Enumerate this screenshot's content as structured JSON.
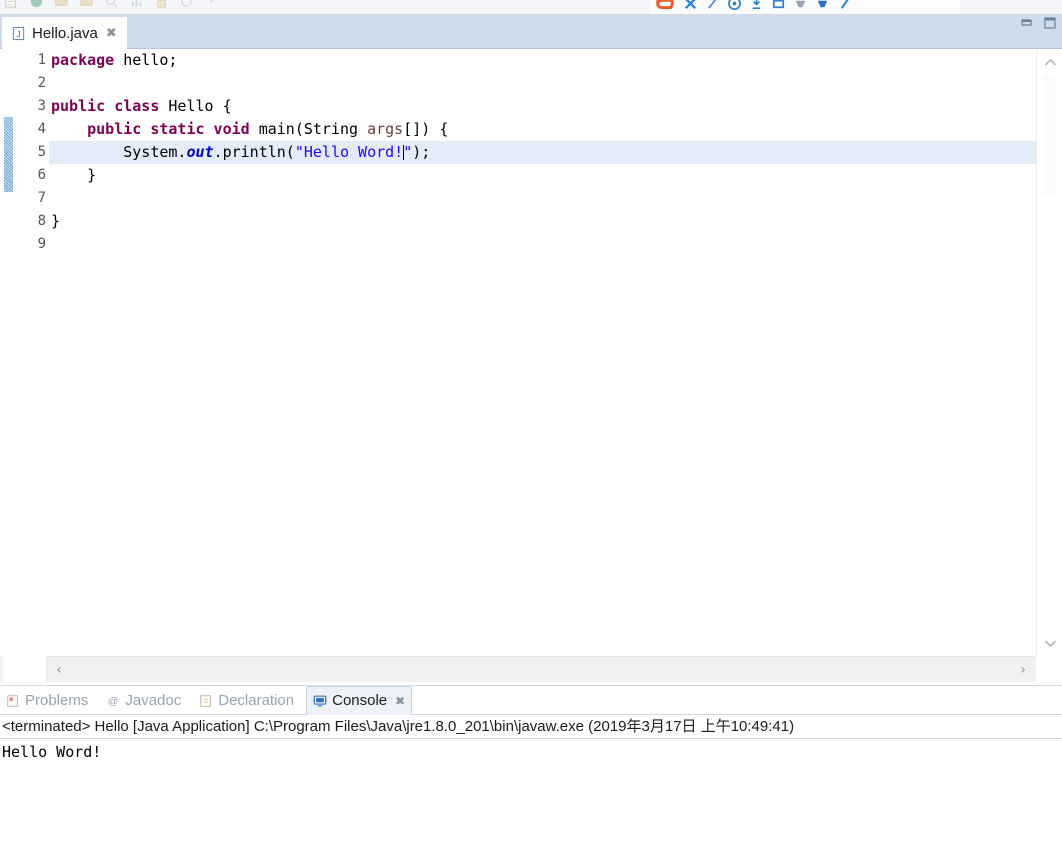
{
  "toolbar": {
    "left_icons": [
      "new-icon",
      "save-icon",
      "print-icon",
      "export-icon",
      "import-icon",
      "search-icon",
      "chart-icon",
      "lock-icon",
      "refresh-icon",
      "more-icon"
    ],
    "right_icons": [
      "browser-logo-icon",
      "text-tool-icon",
      "pen-icon",
      "smiley-icon",
      "crop-icon",
      "frame-icon",
      "shape-icon",
      "fill-icon",
      "brush-icon"
    ],
    "accent_orange": "#f05a28",
    "accent_blue": "#2f7fd4"
  },
  "window": {
    "minimize_icon": "minimize-icon",
    "maximize_icon": "maximize-icon"
  },
  "editor": {
    "tab": {
      "label": "Hello.java",
      "icon": "java-file-icon",
      "close": "✖"
    },
    "line_numbers": [
      "1",
      "2",
      "3",
      "4",
      "5",
      "6",
      "7",
      "8",
      "9"
    ],
    "fold_line": 4,
    "current_line": 5,
    "code": [
      [
        {
          "t": "package",
          "c": "kw"
        },
        {
          "t": " hello;",
          "c": "plain"
        }
      ],
      [
        {
          "t": "",
          "c": "plain"
        }
      ],
      [
        {
          "t": "public class",
          "c": "kw"
        },
        {
          "t": " Hello {",
          "c": "plain"
        }
      ],
      [
        {
          "t": "    ",
          "c": "plain"
        },
        {
          "t": "public static void",
          "c": "kw"
        },
        {
          "t": " main(String ",
          "c": "plain"
        },
        {
          "t": "args",
          "c": "param"
        },
        {
          "t": "[]) {",
          "c": "plain"
        }
      ],
      [
        {
          "t": "        System.",
          "c": "plain"
        },
        {
          "t": "out",
          "c": "field"
        },
        {
          "t": ".println(",
          "c": "plain"
        },
        {
          "t": "\"Hello Word!",
          "c": "str"
        },
        {
          "t": "|caret|",
          "c": "caret"
        },
        {
          "t": "\"",
          "c": "str"
        },
        {
          "t": ");",
          "c": "plain"
        }
      ],
      [
        {
          "t": "    }",
          "c": "plain"
        }
      ],
      [
        {
          "t": "",
          "c": "plain"
        }
      ],
      [
        {
          "t": "}",
          "c": "plain"
        }
      ],
      [
        {
          "t": "",
          "c": "plain"
        }
      ]
    ],
    "scroll": {
      "up_arrow": "chevron-up-icon",
      "down_arrow": "chevron-down-icon",
      "left_arrow": "‹",
      "right_arrow": "›"
    }
  },
  "bottom_view": {
    "tabs": [
      {
        "label": "Problems",
        "icon": "problems-icon",
        "active": false,
        "closable": false
      },
      {
        "label": "Javadoc",
        "icon": "javadoc-icon",
        "active": false,
        "closable": false
      },
      {
        "label": "Declaration",
        "icon": "declaration-icon",
        "active": false,
        "closable": false
      },
      {
        "label": "Console",
        "icon": "console-icon",
        "active": true,
        "closable": true
      }
    ],
    "close_glyph": "✖",
    "status_line": "<terminated> Hello [Java Application] C:\\Program Files\\Java\\jre1.8.0_201\\bin\\javaw.exe (2019年3月17日 上午10:49:41)",
    "output": "Hello Word!"
  }
}
